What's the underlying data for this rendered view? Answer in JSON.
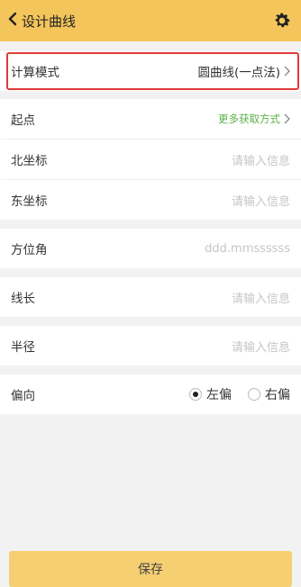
{
  "header": {
    "title": "设计曲线"
  },
  "form": {
    "calc_mode": {
      "label": "计算模式",
      "value": "圆曲线(一点法)"
    },
    "start_point": {
      "label": "起点",
      "link": "更多获取方式"
    },
    "north": {
      "label": "北坐标",
      "placeholder": "请输入信息"
    },
    "east": {
      "label": "东坐标",
      "placeholder": "请输入信息"
    },
    "azimuth": {
      "label": "方位角",
      "placeholder": "ddd.mmssssss"
    },
    "length": {
      "label": "线长",
      "placeholder": "请输入信息"
    },
    "radius": {
      "label": "半径",
      "placeholder": "请输入信息"
    },
    "deflection": {
      "label": "偏向",
      "options": [
        "左偏",
        "右偏"
      ],
      "selected": "左偏"
    }
  },
  "footer": {
    "save_label": "保存"
  },
  "colors": {
    "header_bg": "#f4c55b",
    "accent_green": "#5db14a",
    "highlight_red": "#e03a3a",
    "save_bg": "#f6cf72"
  }
}
